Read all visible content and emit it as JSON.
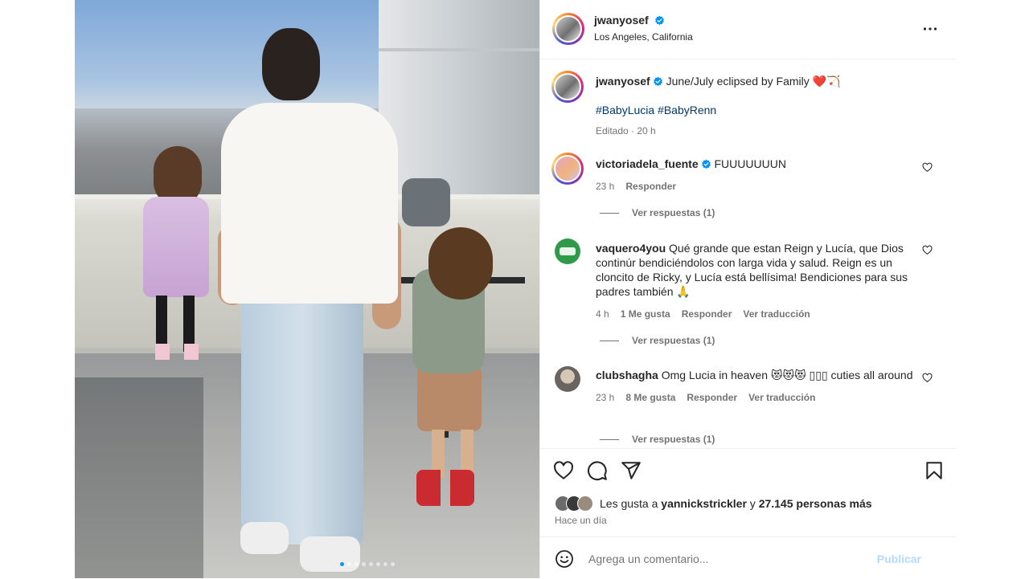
{
  "post": {
    "photo_alt_label": "",
    "carousel": {
      "slides": 8,
      "active_index": 0
    }
  },
  "author": {
    "username": "jwanyosef",
    "location": "Los Angeles, California",
    "verified_icon": "verified-badge-icon"
  },
  "caption": {
    "username": "jwanyosef",
    "text": "June/July eclipsed by Family ❤️🏹",
    "hashtags": "#BabyLucia #BabyRenn",
    "meta": "Editado · 20 h"
  },
  "comments": [
    {
      "username": "victoriadela_fuente",
      "verified": true,
      "text": "FUUUUUUUN",
      "time": "23 h",
      "likes": "",
      "reply_label": "Responder",
      "translate_label": "",
      "view_replies": "Ver respuestas (1)"
    },
    {
      "username": "vaquero4you",
      "verified": false,
      "text": "Qué grande que estan Reign y Lucía, que Dios continúr bendiciéndolos con larga vida y salud. Reign es un cloncito de Ricky, y Lucía está bellísima! Bendiciones para sus padres también 🙏",
      "time": "4 h",
      "likes": "1 Me gusta",
      "reply_label": "Responder",
      "translate_label": "Ver traducción",
      "view_replies": "Ver respuestas (1)"
    },
    {
      "username": "clubshagha",
      "verified": false,
      "text": "Omg Lucia in heaven 😻😻😻 ▯▯▯ cuties all around",
      "time": "23 h",
      "likes": "8 Me gusta",
      "reply_label": "Responder",
      "translate_label": "Ver traducción",
      "view_replies": "Ver respuestas (1)"
    }
  ],
  "likes": {
    "prefix": "Les gusta a ",
    "user": "yannickstrickler",
    "middle": " y ",
    "count": "27.145 personas más",
    "time_ago": "Hace un día"
  },
  "composer": {
    "placeholder": "Agrega un comentario...",
    "publish_label": "Publicar"
  },
  "colors": {
    "accent_blue": "#0095f6",
    "link_blue": "#00376b",
    "publish_disabled": "#b3dbff",
    "muted_text": "#737373"
  },
  "icons": [
    "more-options-icon",
    "heart-icon",
    "comment-icon",
    "share-icon",
    "save-icon",
    "emoji-icon",
    "chevron-right-icon",
    "verified-badge-icon"
  ]
}
